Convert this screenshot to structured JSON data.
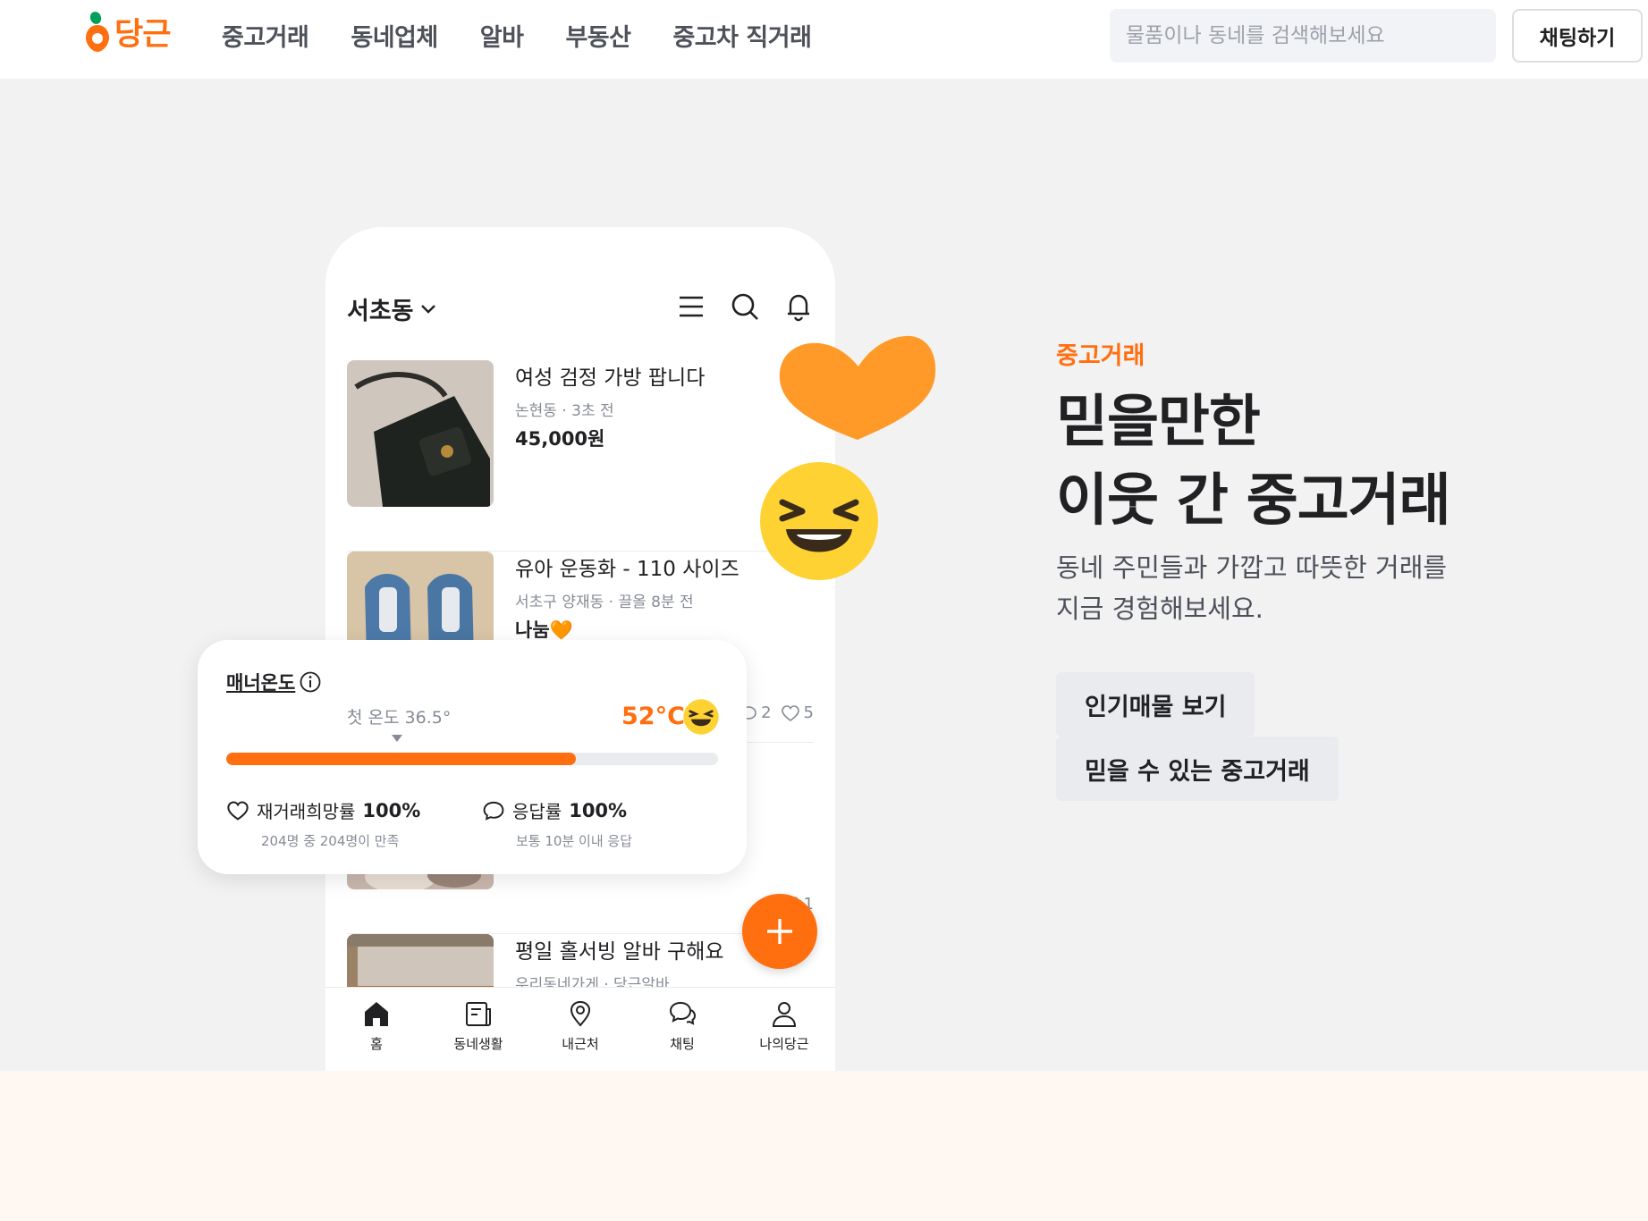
{
  "header": {
    "logo_text": "당근",
    "nav": [
      "중고거래",
      "동네업체",
      "알바",
      "부동산",
      "중고차 직거래"
    ],
    "search_placeholder": "물품이나 동네를 검색해보세요",
    "chat_button": "채팅하기"
  },
  "phone": {
    "location": "서초동",
    "items": [
      {
        "title": "여성 검정 가방 팝니다",
        "meta": "논현동 · 3초 전",
        "price": "45,000원"
      },
      {
        "title": "유아 운동화 - 110 사이즈",
        "meta": "서초구 양재동 · 끌올 8분 전",
        "price": "나눔🧡",
        "chats": "2",
        "likes": "5"
      },
      {
        "likes": "1"
      },
      {
        "title": "평일 홀서빙 알바 구해요",
        "meta": "우리동네가게 · 당근알바"
      }
    ],
    "tabs": [
      "홈",
      "동네생활",
      "내근처",
      "채팅",
      "나의당근"
    ]
  },
  "manner": {
    "title": "매너온도",
    "first_temp": "첫 온도 36.5°",
    "temp": "52°C",
    "progress": 0.71,
    "stat1_label": "재거래희망률",
    "stat1_value": "100%",
    "stat1_sub": "204명 중 204명이 만족",
    "stat2_label": "응답률",
    "stat2_value": "100%",
    "stat2_sub": "보통 10분 이내 응답"
  },
  "hero": {
    "tag": "중고거래",
    "title_line1": "믿을만한",
    "title_line2": "이웃 간 중고거래",
    "desc_line1": "동네 주민들과 가깝고 따뜻한 거래를",
    "desc_line2": "지금 경험해보세요.",
    "button1": "인기매물 보기",
    "button2": "믿을 수 있는 중고거래"
  },
  "colors": {
    "brand": "#ff6f0f",
    "heart": "#ff9a28",
    "emoji": "#ffd233"
  }
}
